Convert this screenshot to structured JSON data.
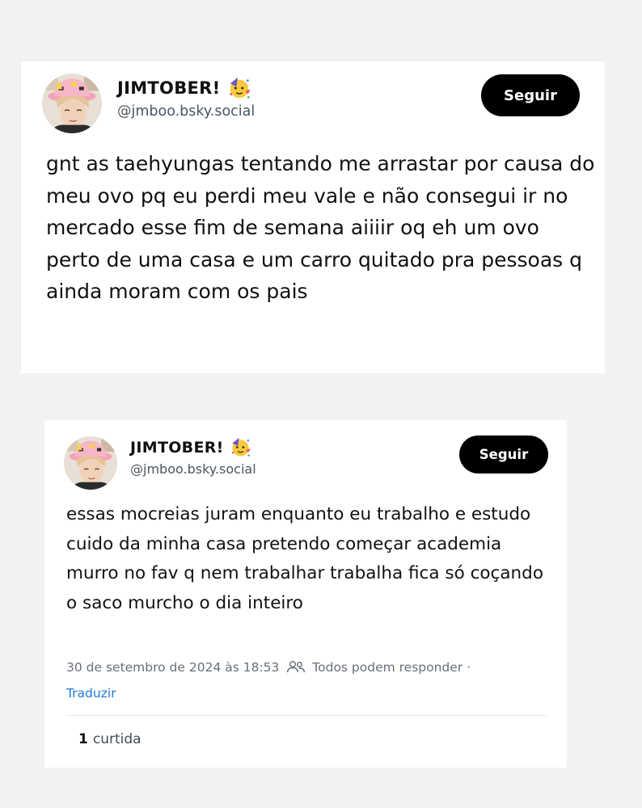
{
  "posts": [
    {
      "display_name": "JIMTOBER!",
      "avatar_icon": "profile-photo-avatar",
      "name_emoji": "partying-face-emoji",
      "handle": "@jmboo.bsky.social",
      "follow_label": "Seguir",
      "text": "gnt as taehyungas tentando me arrastar por causa do meu ovo pq eu perdi meu vale e não consegui ir no mercado esse fim de semana aiiiir oq eh um ovo perto de uma casa e um carro quitado pra pessoas q ainda moram com os pais"
    },
    {
      "display_name": "JIMTOBER!",
      "avatar_icon": "profile-photo-avatar",
      "name_emoji": "partying-face-emoji",
      "handle": "@jmboo.bsky.social",
      "follow_label": "Seguir",
      "text": "essas mocreias juram enquanto eu trabalho e estudo cuido da minha casa pretendo começar academia murro no fav q nem trabalhar trabalha fica só coçando o saco murcho o dia inteiro",
      "timestamp": "30 de setembro de 2024 às 18:53",
      "reply_icon": "people-icon",
      "reply_setting": "Todos podem responder",
      "separator": "·",
      "translate_label": "Traduzir",
      "like_count": "1",
      "like_label": "curtida"
    }
  ],
  "colors": {
    "background": "#f2f2f4",
    "card": "#ffffff",
    "button": "#000000",
    "link": "#1d7ad6",
    "muted": "#66707c"
  }
}
